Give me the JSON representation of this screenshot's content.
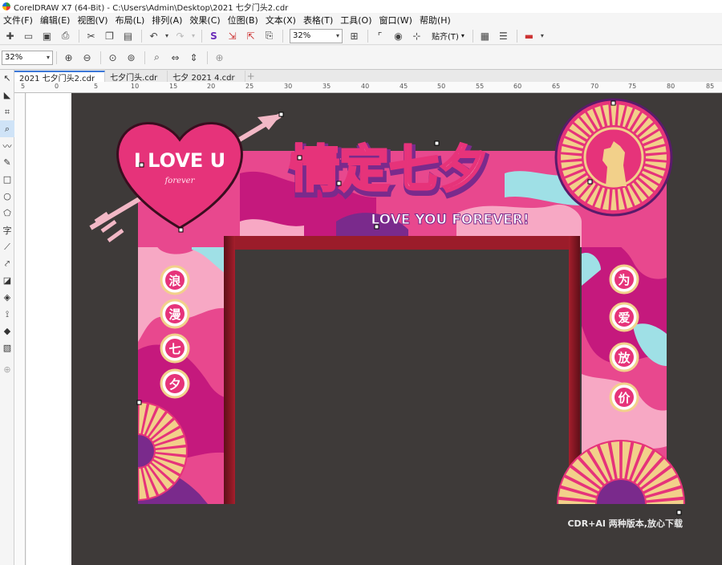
{
  "window": {
    "title": "CorelDRAW X7 (64-Bit) - C:\\Users\\Admin\\Desktop\\2021 七夕门头2.cdr"
  },
  "menu": [
    "文件(F)",
    "编辑(E)",
    "视图(V)",
    "布局(L)",
    "排列(A)",
    "效果(C)",
    "位图(B)",
    "文本(X)",
    "表格(T)",
    "工具(O)",
    "窗口(W)",
    "帮助(H)"
  ],
  "toolbar": {
    "zoom_value": "32%",
    "snap_label": "贴齐(T)"
  },
  "toolbar2": {
    "zoom_value": "32%"
  },
  "tabs": [
    "2021 七夕门头2.cdr",
    "七夕门头.cdr",
    "七夕 2021 4.cdr"
  ],
  "ruler": [
    "5",
    "0",
    "5",
    "10",
    "15",
    "20",
    "25",
    "30",
    "35",
    "40",
    "45",
    "50",
    "55",
    "60",
    "65",
    "70",
    "75",
    "80",
    "85"
  ],
  "design": {
    "heart_text": "I LOVE U",
    "heart_script": "forever",
    "title": "情定七夕",
    "subtitle": "LOVE YOU FOREVER!",
    "left_chars": [
      "浪",
      "漫",
      "七",
      "夕"
    ],
    "right_chars": [
      "为",
      "爱",
      "放",
      "价"
    ],
    "watermark": "CDR+AI 两种版本,放心下载"
  },
  "colors": {
    "canvas": "#3e3a39",
    "pink": "#e6337a",
    "magenta": "#c5197d",
    "purple": "#7a2a8c",
    "gold": "#f2d08a",
    "cyan": "#9fe0e6",
    "red_frame": "#9b1c2a"
  }
}
